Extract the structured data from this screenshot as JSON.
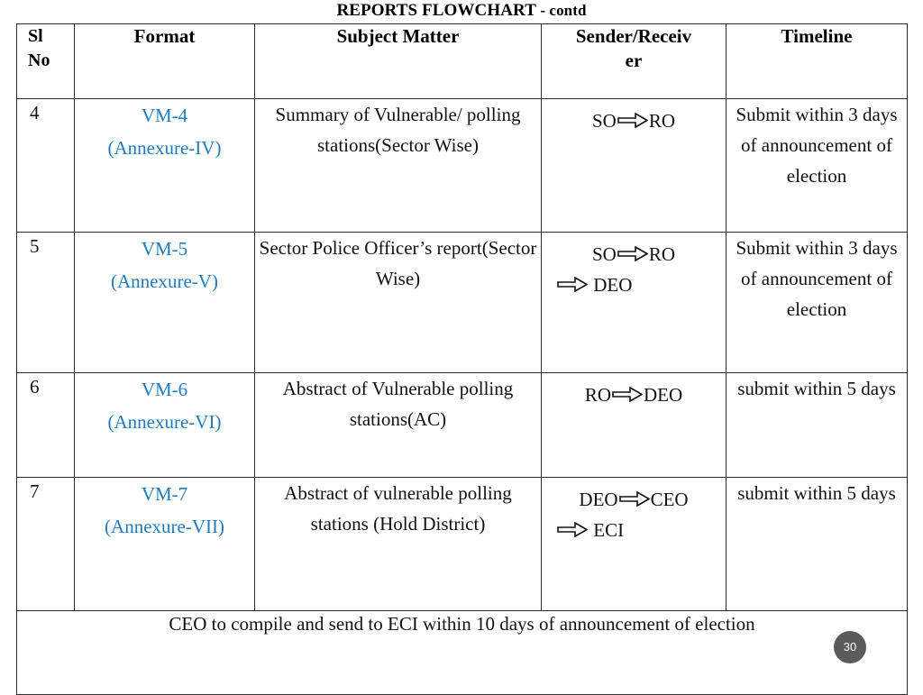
{
  "slide": {
    "title_main": "REPORTS FLOWCHART",
    "title_suffix": " - contd",
    "page_number": "30",
    "accent_blue": "#1F7BC0",
    "badge_color": "#5B5B5B",
    "border_color": "#2B2B2B"
  },
  "table": {
    "headers": {
      "sl_no_line1": "Sl",
      "sl_no_line2": "No",
      "format": "Format",
      "subject_matter": "Subject Matter",
      "sender_receiver_line1": "Sender/Receiv",
      "sender_receiver_line2": "er",
      "timeline": "Timeline"
    },
    "rows": [
      {
        "sl_no": "4",
        "format_code": "VM-4",
        "format_annexure": "(Annexure-IV)",
        "subject_matter": "Summary of Vulnerable/ polling stations(Sector Wise)",
        "sender_line1_from": "SO",
        "sender_line1_to": "RO",
        "sender_line2_from": "",
        "sender_line2_to": "",
        "timeline": "Submit within 3 days of announcement of election"
      },
      {
        "sl_no": "5",
        "format_code": "VM-5",
        "format_annexure": "(Annexure-V)",
        "subject_matter": "Sector Police Officer’s report(Sector Wise)",
        "sender_line1_from": "SO",
        "sender_line1_to": "RO",
        "sender_line2_from": "",
        "sender_line2_to": "DEO",
        "timeline": "Submit within 3 days of announcement of election"
      },
      {
        "sl_no": "6",
        "format_code": "VM-6",
        "format_annexure": "(Annexure-VI)",
        "subject_matter": "Abstract of Vulnerable polling stations(AC)",
        "sender_line1_from": "RO",
        "sender_line1_to": "DEO",
        "sender_line2_from": "",
        "sender_line2_to": "",
        "timeline": "submit within 5 days"
      },
      {
        "sl_no": "7",
        "format_code": "VM-7",
        "format_annexure": "(Annexure-VII)",
        "subject_matter": "Abstract of vulnerable polling stations (Hold District)",
        "sender_line1_from": "DEO",
        "sender_line1_to": "CEO",
        "sender_line2_from": "",
        "sender_line2_to": "ECI",
        "timeline": "submit within 5 days"
      }
    ],
    "footer_note": "CEO to compile and send to ECI within 10 days of announcement of election"
  }
}
